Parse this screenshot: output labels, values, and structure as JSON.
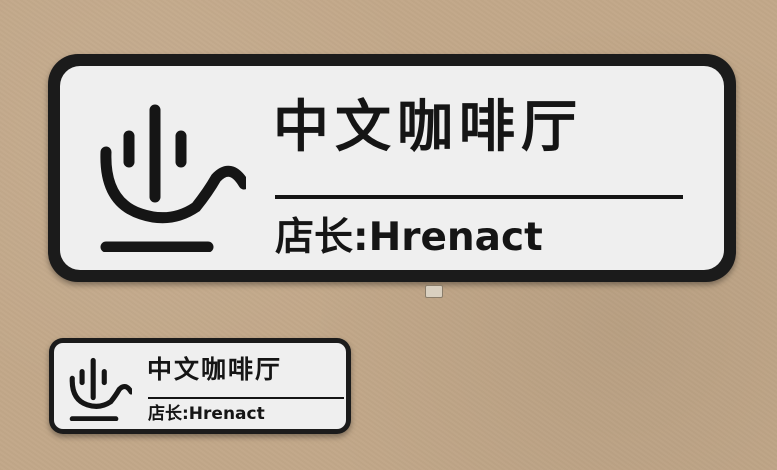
{
  "scene": {
    "background_color": "#c2a889",
    "plaque_border_color": "#1b1b1b",
    "plaque_face_color": "#efefef",
    "ink_color": "#151515"
  },
  "large_plaque": {
    "logo": "cup-icon",
    "title": "中文咖啡厅",
    "owner": "店长:Hrenact"
  },
  "small_plaque": {
    "logo": "cup-icon",
    "title": "中文咖啡厅",
    "owner": "店长:Hrenact"
  }
}
